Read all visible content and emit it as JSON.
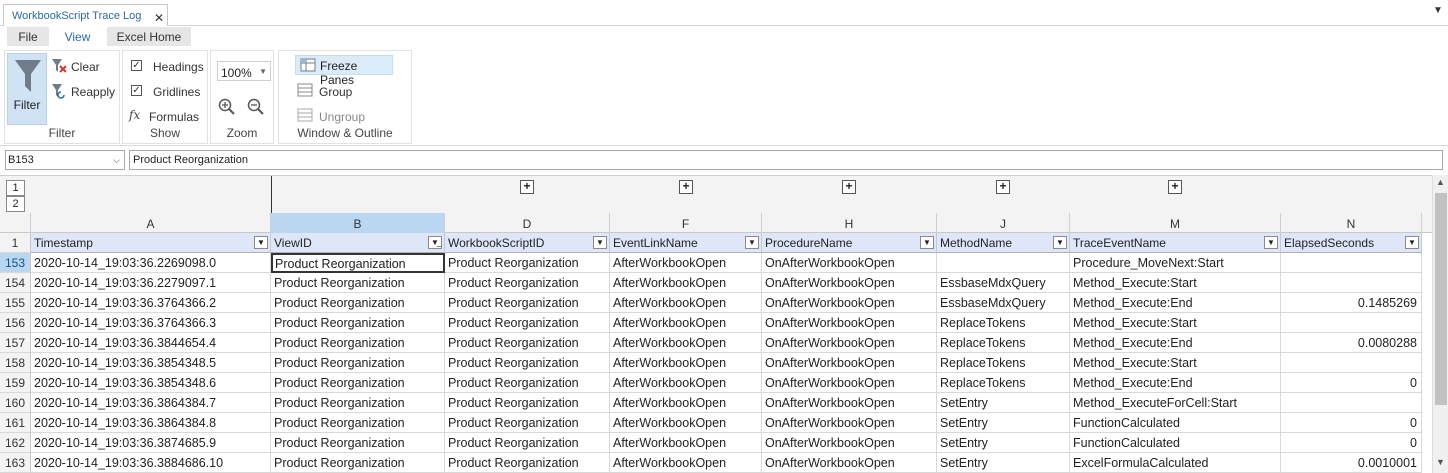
{
  "window": {
    "tab_title": "WorkbookScript Trace Log",
    "close_glyph": "✕",
    "menu_glyph": "▼"
  },
  "ribbon": {
    "tabs": [
      "File",
      "View",
      "Excel Home"
    ],
    "filter_group": {
      "label": "Filter",
      "filter": "Filter",
      "clear": "Clear",
      "reapply": "Reapply"
    },
    "show_group": {
      "label": "Show",
      "headings": "Headings",
      "gridlines": "Gridlines",
      "formulas": "Formulas",
      "headings_checked": true,
      "gridlines_checked": true
    },
    "zoom_group": {
      "label": "Zoom",
      "zoom_value": "100%"
    },
    "window_group": {
      "label": "Window & Outline",
      "freeze": "Freeze Panes",
      "group": "Group",
      "ungroup": "Ungroup"
    }
  },
  "formula_bar": {
    "name_box": "B153",
    "value": "Product Reorganization"
  },
  "grid": {
    "outline_levels": [
      "1",
      "2"
    ],
    "column_letters": [
      "A",
      "B",
      "D",
      "F",
      "H",
      "J",
      "M",
      "N"
    ],
    "header_row_number": "1",
    "headers": [
      "Timestamp",
      "ViewID",
      "WorkbookScriptID",
      "EventLinkName",
      "ProcedureName",
      "MethodName",
      "TraceEventName",
      "ElapsedSeconds"
    ],
    "rows": [
      {
        "n": "153",
        "c": [
          "2020-10-14_19:03:36.2269098.0",
          "Product Reorganization",
          "Product Reorganization",
          "AfterWorkbookOpen",
          "OnAfterWorkbookOpen",
          "",
          "Procedure_MoveNext:Start",
          ""
        ]
      },
      {
        "n": "154",
        "c": [
          "2020-10-14_19:03:36.2279097.1",
          "Product Reorganization",
          "Product Reorganization",
          "AfterWorkbookOpen",
          "OnAfterWorkbookOpen",
          "EssbaseMdxQuery",
          "Method_Execute:Start",
          ""
        ]
      },
      {
        "n": "155",
        "c": [
          "2020-10-14_19:03:36.3764366.2",
          "Product Reorganization",
          "Product Reorganization",
          "AfterWorkbookOpen",
          "OnAfterWorkbookOpen",
          "EssbaseMdxQuery",
          "Method_Execute:End",
          "0.1485269"
        ]
      },
      {
        "n": "156",
        "c": [
          "2020-10-14_19:03:36.3764366.3",
          "Product Reorganization",
          "Product Reorganization",
          "AfterWorkbookOpen",
          "OnAfterWorkbookOpen",
          "ReplaceTokens",
          "Method_Execute:Start",
          ""
        ]
      },
      {
        "n": "157",
        "c": [
          "2020-10-14_19:03:36.3844654.4",
          "Product Reorganization",
          "Product Reorganization",
          "AfterWorkbookOpen",
          "OnAfterWorkbookOpen",
          "ReplaceTokens",
          "Method_Execute:End",
          "0.0080288"
        ]
      },
      {
        "n": "158",
        "c": [
          "2020-10-14_19:03:36.3854348.5",
          "Product Reorganization",
          "Product Reorganization",
          "AfterWorkbookOpen",
          "OnAfterWorkbookOpen",
          "ReplaceTokens",
          "Method_Execute:Start",
          ""
        ]
      },
      {
        "n": "159",
        "c": [
          "2020-10-14_19:03:36.3854348.6",
          "Product Reorganization",
          "Product Reorganization",
          "AfterWorkbookOpen",
          "OnAfterWorkbookOpen",
          "ReplaceTokens",
          "Method_Execute:End",
          "0"
        ]
      },
      {
        "n": "160",
        "c": [
          "2020-10-14_19:03:36.3864384.7",
          "Product Reorganization",
          "Product Reorganization",
          "AfterWorkbookOpen",
          "OnAfterWorkbookOpen",
          "SetEntry",
          "Method_ExecuteForCell:Start",
          ""
        ]
      },
      {
        "n": "161",
        "c": [
          "2020-10-14_19:03:36.3864384.8",
          "Product Reorganization",
          "Product Reorganization",
          "AfterWorkbookOpen",
          "OnAfterWorkbookOpen",
          "SetEntry",
          "FunctionCalculated",
          "0"
        ]
      },
      {
        "n": "162",
        "c": [
          "2020-10-14_19:03:36.3874685.9",
          "Product Reorganization",
          "Product Reorganization",
          "AfterWorkbookOpen",
          "OnAfterWorkbookOpen",
          "SetEntry",
          "FunctionCalculated",
          "0"
        ]
      },
      {
        "n": "163",
        "c": [
          "2020-10-14_19:03:36.3884686.10",
          "Product Reorganization",
          "Product Reorganization",
          "AfterWorkbookOpen",
          "OnAfterWorkbookOpen",
          "SetEntry",
          "ExcelFormulaCalculated",
          "0.0010001"
        ]
      }
    ]
  },
  "colors": {
    "accent": "#2b6aa6",
    "selection": "#b9d7f0",
    "header_fill": "#dfe6f7"
  }
}
